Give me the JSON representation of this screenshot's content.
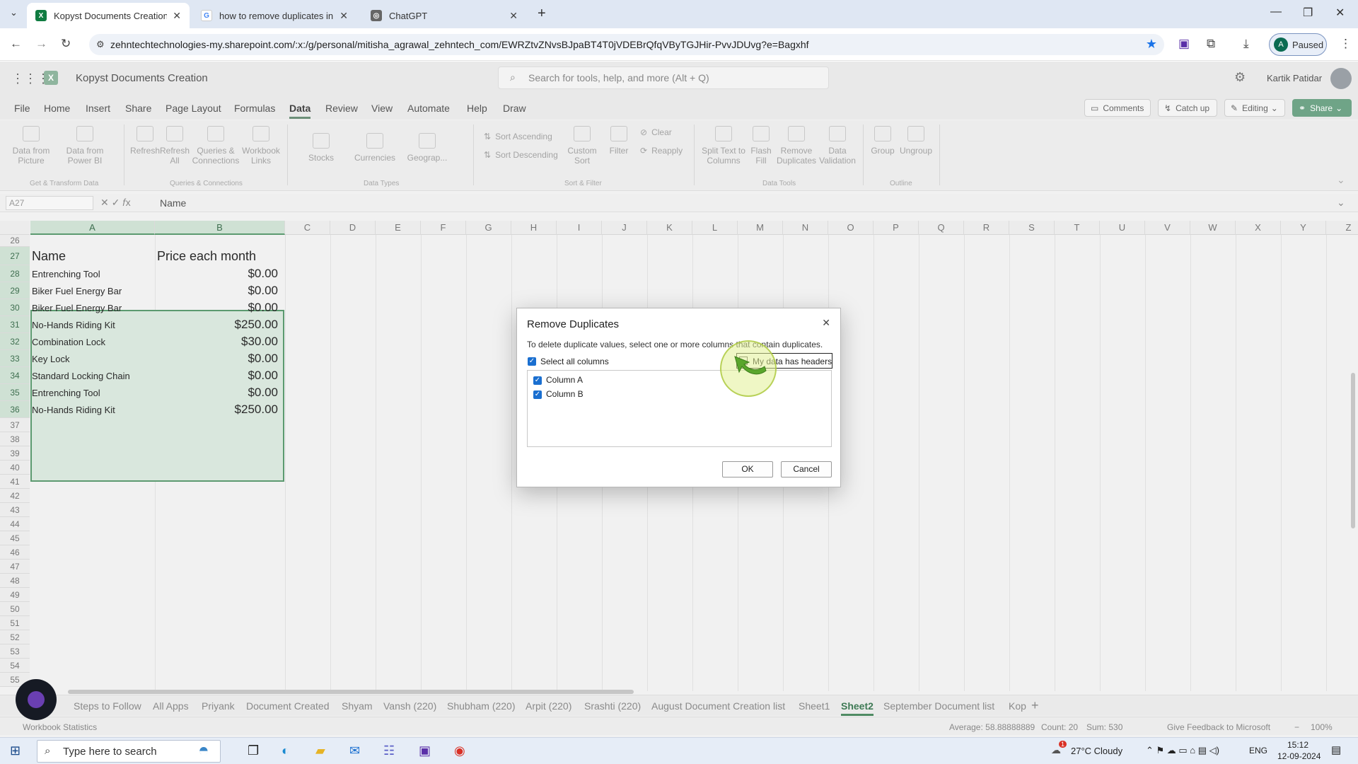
{
  "browser": {
    "tabs": [
      {
        "title": "Kopyst Documents Creation.xlsx",
        "icon": "excel-icon"
      },
      {
        "title": "how to remove duplicates in ex",
        "icon": "google-icon"
      },
      {
        "title": "ChatGPT",
        "icon": "chatgpt-icon"
      }
    ],
    "url": "zehntechtechnologies-my.sharepoint.com/:x:/g/personal/mitisha_agrawal_zehntech_com/EWRZtvZNvsBJpaBT4T0jVDEBrQfqVByTGJHir-PvvJDUvg?e=Bagxhf",
    "profile_initial": "A",
    "profile_status": "Paused"
  },
  "app": {
    "title": "Kopyst Documents Creation",
    "search_placeholder": "Search for tools, help, and more (Alt + Q)",
    "user_name": "Kartik Patidar",
    "menu": [
      "File",
      "Home",
      "Insert",
      "Share",
      "Page Layout",
      "Formulas",
      "Data",
      "Review",
      "View",
      "Automate",
      "Help",
      "Draw"
    ],
    "active_menu": "Data",
    "comments_label": "Comments",
    "catchup_label": "Catch up",
    "editing_label": "Editing",
    "share_label": "Share"
  },
  "ribbon": {
    "buttons": [
      {
        "label": "Data from Picture"
      },
      {
        "label": "Data from Power BI"
      },
      {
        "label": "Refresh"
      },
      {
        "label": "Refresh All"
      },
      {
        "label": "Queries & Connections"
      },
      {
        "label": "Workbook Links"
      },
      {
        "label": "Stocks"
      },
      {
        "label": "Currencies"
      },
      {
        "label": "Geograp..."
      },
      {
        "label": "Sort Ascending"
      },
      {
        "label": "Sort Descending"
      },
      {
        "label": "Custom Sort"
      },
      {
        "label": "Filter"
      },
      {
        "label": "Clear"
      },
      {
        "label": "Reapply"
      },
      {
        "label": "Split Text to Columns"
      },
      {
        "label": "Flash Fill"
      },
      {
        "label": "Remove Duplicates"
      },
      {
        "label": "Data Validation"
      },
      {
        "label": "Group"
      },
      {
        "label": "Ungroup"
      }
    ],
    "groups": [
      "Get & Transform Data",
      "Queries & Connections",
      "Data Types",
      "Sort & Filter",
      "Data Tools",
      "Outline"
    ]
  },
  "formula_bar": {
    "name_box": "A27",
    "value": "Name"
  },
  "grid": {
    "columns": [
      "A",
      "B",
      "C",
      "D",
      "E",
      "F",
      "G",
      "H",
      "I",
      "J",
      "K",
      "L",
      "M",
      "N",
      "O",
      "P",
      "Q",
      "R",
      "S",
      "T",
      "U",
      "V",
      "W",
      "X",
      "Y",
      "Z"
    ],
    "rows": [
      "26",
      "27",
      "28",
      "29",
      "30",
      "31",
      "32",
      "33",
      "34",
      "35",
      "36",
      "37",
      "38",
      "39",
      "40",
      "41",
      "42",
      "43",
      "44",
      "45",
      "46",
      "47",
      "48",
      "49",
      "50",
      "51",
      "52",
      "53",
      "54",
      "55"
    ],
    "header": {
      "name": "Name",
      "price": "Price each month"
    },
    "data": [
      {
        "name": "Entrenching Tool",
        "price": "$0.00"
      },
      {
        "name": "Biker Fuel Energy Bar",
        "price": "$0.00"
      },
      {
        "name": "Biker Fuel Energy Bar",
        "price": "$0.00"
      },
      {
        "name": "No-Hands Riding Kit",
        "price": "$250.00"
      },
      {
        "name": "Combination Lock",
        "price": "$30.00"
      },
      {
        "name": "Key Lock",
        "price": "$0.00"
      },
      {
        "name": "Standard Locking Chain",
        "price": "$0.00"
      },
      {
        "name": "Entrenching Tool",
        "price": "$0.00"
      },
      {
        "name": "No-Hands Riding Kit",
        "price": "$250.00"
      }
    ]
  },
  "dialog": {
    "title": "Remove Duplicates",
    "description": "To delete duplicate values, select one or more columns that contain duplicates.",
    "select_all_label": "Select all columns",
    "headers_label": "My data has headers",
    "columns": [
      "Column A",
      "Column B"
    ],
    "ok_label": "OK",
    "cancel_label": "Cancel"
  },
  "sheets": {
    "tabs": [
      "Steps to Follow",
      "All Apps",
      "Priyank",
      "Document Created",
      "Shyam",
      "Vansh (220)",
      "Shubham (220)",
      "Arpit (220)",
      "Srashti (220)",
      "August Document Creation list",
      "Sheet1",
      "Sheet2",
      "September Document list",
      "Kop"
    ],
    "active": "Sheet2"
  },
  "status_bar": {
    "left": "Workbook Statistics",
    "average": "Average: 58.88888889",
    "count": "Count: 20",
    "sum": "Sum: 530",
    "feedback": "Give Feedback to Microsoft",
    "zoom": "100%"
  },
  "taskbar": {
    "search_placeholder": "Type here to search",
    "weather": "27°C  Cloudy",
    "language": "ENG",
    "time": "15:12",
    "date": "12-09-2024",
    "weather_badge": "1"
  }
}
